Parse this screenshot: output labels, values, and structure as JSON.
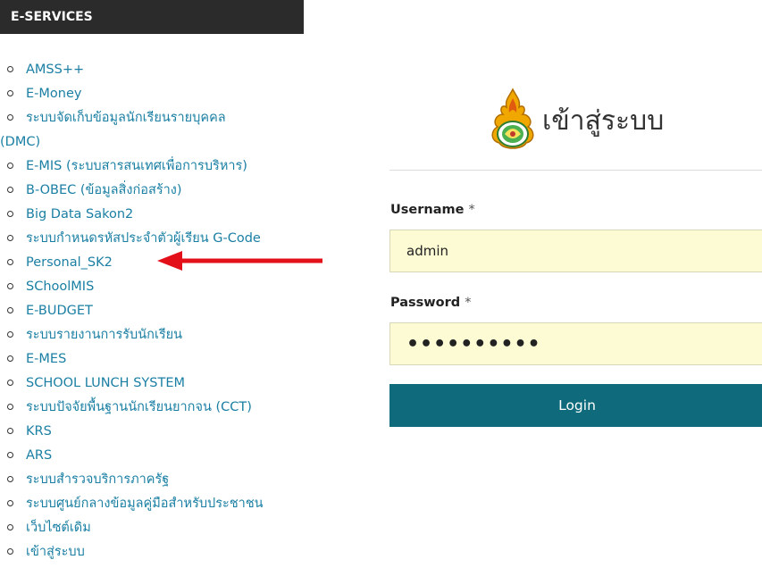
{
  "sidebar": {
    "header": "E-SERVICES",
    "items": [
      {
        "label": "AMSS++"
      },
      {
        "label": "E-Money"
      },
      {
        "label": "ระบบจัดเก็บข้อมูลนักเรียนรายบุคคล",
        "label_cont": "(DMC)"
      },
      {
        "label": "E-MIS (ระบบสารสนเทศเพื่อการบริหาร)"
      },
      {
        "label": "B-OBEC (ข้อมูลสิ่งก่อสร้าง)"
      },
      {
        "label": "Big Data Sakon2"
      },
      {
        "label": "ระบบกำหนดรหัสประจำตัวผู้เรียน G-Code"
      },
      {
        "label": "Personal_SK2"
      },
      {
        "label": "SChoolMIS"
      },
      {
        "label": "E-BUDGET"
      },
      {
        "label": "ระบบรายงานการรับนักเรียน"
      },
      {
        "label": "E-MES"
      },
      {
        "label": "SCHOOL LUNCH SYSTEM"
      },
      {
        "label": "ระบบปัจจัยพื้นฐานนักเรียนยากจน (CCT)"
      },
      {
        "label": "KRS"
      },
      {
        "label": "ARS"
      },
      {
        "label": "ระบบสำรวจบริการภาครัฐ"
      },
      {
        "label": "ระบบศูนย์กลางข้อมูลคู่มือสำหรับประชาชน"
      },
      {
        "label": "เว็บไซต์เดิม"
      },
      {
        "label": "เข้าสู่ระบบ"
      }
    ]
  },
  "annotation": {
    "arrow_target": "Personal_SK2",
    "arrow_color": "#e3101a"
  },
  "login": {
    "logo_icon": "obec-emblem-icon",
    "title": "เข้าสู่ระบบ",
    "username_label": "Username",
    "username_value": "admin",
    "password_label": "Password",
    "password_value": "••••••••••",
    "required_mark": "*",
    "submit_label": "Login"
  },
  "colors": {
    "header_bg": "#2b2b2b",
    "link": "#1a7fa3",
    "input_bg": "#fcfbd4",
    "button_bg": "#0f6b7c"
  }
}
